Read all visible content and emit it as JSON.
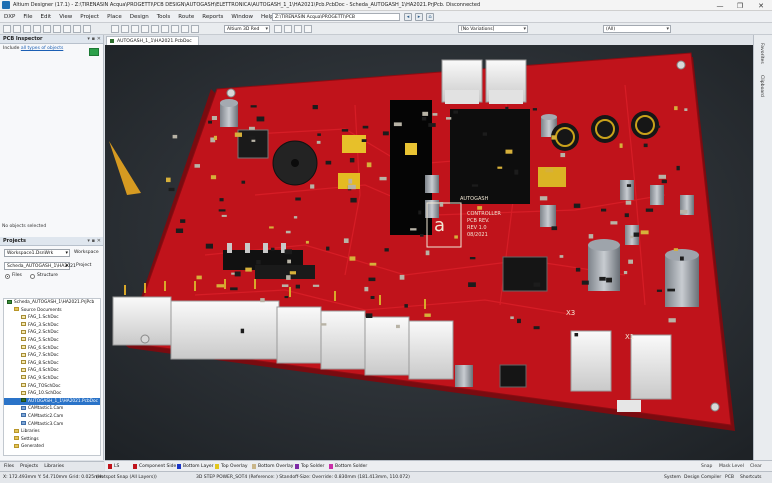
{
  "window": {
    "title": "Altium Designer (17.1) - Z:\\TIRENASIN Acqua\\PROGETTI\\PCB DESIGN\\AUTOGASH\\ELETTRONICA\\AUTOGASH_1_1\\HA2021\\Pcb.PcbDoc - Scheda_AUTOGASH_1\\HA2021.PrjPcb. Disconnected",
    "controls": [
      "—",
      "❐",
      "✕"
    ]
  },
  "menu": {
    "items": [
      "DXP",
      "File",
      "Edit",
      "View",
      "Project",
      "Place",
      "Design",
      "Tools",
      "Route",
      "Reports",
      "Window",
      "Help"
    ],
    "path": "Z:\\TIRENASIN Acqua\\PROGETTI\\PCB"
  },
  "toolbar": {
    "view_mode": "Altium 3D Red",
    "variant": "[No Variations]",
    "filter": "(All)"
  },
  "pcb_inspector": {
    "title": "PCB Inspector",
    "include_label": "Include",
    "include_link": "all types of objects",
    "no_objects": "No objects selected"
  },
  "projects": {
    "title": "Projects",
    "workspace": "Workspace1.DsnWrk",
    "workspace_btn": "Workspace",
    "project_name": "Scheda_AUTOGASH_1\\HA2021",
    "project_btn": "Project",
    "view_file": "Files",
    "view_struct": "Structure",
    "tree": [
      {
        "label": "Scheda_AUTOGASH_1\\HA2021.PrjPcb",
        "level": 0,
        "icon": "proj",
        "selected": false
      },
      {
        "label": "Source Documents",
        "level": 1,
        "icon": "folder",
        "selected": false
      },
      {
        "label": "FAG_1.SchDoc",
        "level": 2,
        "icon": "sch",
        "selected": false
      },
      {
        "label": "FAG_3.SchDoc",
        "level": 2,
        "icon": "sch",
        "selected": false
      },
      {
        "label": "FAG_2.SchDoc",
        "level": 2,
        "icon": "sch",
        "selected": false
      },
      {
        "label": "FAG_5.SchDoc",
        "level": 2,
        "icon": "sch",
        "selected": false
      },
      {
        "label": "FAG_6.SchDoc",
        "level": 2,
        "icon": "sch",
        "selected": false
      },
      {
        "label": "FAG_7.SchDoc",
        "level": 2,
        "icon": "sch",
        "selected": false
      },
      {
        "label": "FAG_8.SchDoc",
        "level": 2,
        "icon": "sch",
        "selected": false
      },
      {
        "label": "FAG_4.SchDoc",
        "level": 2,
        "icon": "sch",
        "selected": false
      },
      {
        "label": "FAG_9.SchDoc",
        "level": 2,
        "icon": "sch",
        "selected": false
      },
      {
        "label": "FAG_TOSchDoc",
        "level": 2,
        "icon": "sch",
        "selected": false
      },
      {
        "label": "FAG_10.SchDoc",
        "level": 2,
        "icon": "sch",
        "selected": false
      },
      {
        "label": "AUTOGASH_1_1\\HA2021.PcbDoc",
        "level": 2,
        "icon": "pcb",
        "selected": true
      },
      {
        "label": "CAMtastic1.Cam",
        "level": 2,
        "icon": "cam",
        "selected": false
      },
      {
        "label": "CAMtastic2.Cam",
        "level": 2,
        "icon": "cam",
        "selected": false
      },
      {
        "label": "CAMtastic3.Cam",
        "level": 2,
        "icon": "cam",
        "selected": false
      },
      {
        "label": "Libraries",
        "level": 1,
        "icon": "folder",
        "selected": false
      },
      {
        "label": "Settings",
        "level": 1,
        "icon": "folder",
        "selected": false
      },
      {
        "label": "Generated",
        "level": 1,
        "icon": "folder",
        "selected": false
      }
    ],
    "bottom_tabs": [
      "Files",
      "Projects",
      "Libraries"
    ]
  },
  "document": {
    "tab": "AUTOGASH_1_1\\HA2021.PcbDoc"
  },
  "board": {
    "colors": {
      "pcb": "#c0131b",
      "pcb_edge": "#8c0c12",
      "background": "#2b2f33",
      "silk": "#f1e7d4"
    },
    "silk_texts": [
      "CONTROLLER",
      "PCB REV.",
      "REV 1.0",
      "AUTOGASH",
      "08/2021"
    ],
    "designators": [
      "X3",
      "X1"
    ]
  },
  "rightbar": {
    "tabs": [
      "Favorites",
      "Clipboard"
    ]
  },
  "layers": {
    "tabs": [
      {
        "label": "LS",
        "color": "#c0131b"
      },
      {
        "label": "Component Side",
        "color": "#c0131b"
      },
      {
        "label": "Bottom Layer",
        "color": "#1a35c8"
      },
      {
        "label": "Top Overlay",
        "color": "#e3c71e"
      },
      {
        "label": "Bottom Overlay",
        "color": "#c9b68a"
      },
      {
        "label": "Top Solder",
        "color": "#7e2aa6"
      },
      {
        "label": "Bottom Solder",
        "color": "#c92fa8"
      }
    ],
    "right": [
      "Snap",
      "Mask Level",
      "Clear"
    ]
  },
  "status": {
    "coords": "X: 172.493mm Y: 54.710mm   Grid: 0.025mm",
    "hotspot": "(Hotspot Snap (All Layers))",
    "info": "3D STEP POWER_SOT4 (Reference: )  Standoff-Size: Override: 0.830mm (181.413mm, 110.072)",
    "right_items": [
      "System",
      "Design Compiler",
      "PCB",
      "Shortcuts"
    ]
  }
}
